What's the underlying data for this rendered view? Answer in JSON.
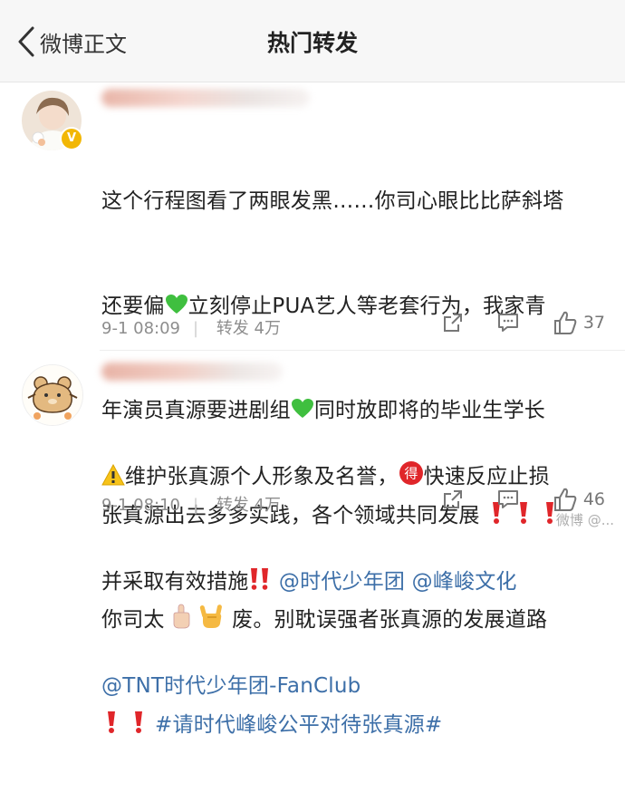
{
  "nav": {
    "back_label": "微博正文",
    "title": "热门转发"
  },
  "posts": [
    {
      "lines": [
        [
          "这个行程图看了两眼发黑……你司心眼比比萨斜塔"
        ],
        [
          "还要偏",
          "立刻停止PUA艺人等老套行为，我家青"
        ],
        [
          "年演员真源要进剧组",
          "同时放即将的毕业生学长"
        ],
        [
          "张真源出去多多实践，各个领域共同发展"
        ],
        [
          "你司太",
          "废。别耽误强者张真源的发展道路"
        ],
        [
          "#请时代峰峻公平对待张真源#"
        ]
      ],
      "time": "9-1 08:09",
      "repost": "转发 4万",
      "likes": "37"
    },
    {
      "lines": [
        [
          "维护张真源个人形象及名誉，",
          "快速反应止损"
        ],
        [
          "并采取有效措施",
          "@时代少年团 @峰峻文化"
        ],
        [
          "@TNT时代少年团-FanClub"
        ]
      ],
      "time": "9-1 08:10",
      "repost": "转发 4万",
      "likes": "46"
    }
  ],
  "badges": {
    "verified": "V",
    "de": "得"
  },
  "colors": {
    "link": "#3d6fa8",
    "heart_green": "#3fbf3f",
    "alert_red": "#e0262a",
    "verified_gold": "#f2b705"
  },
  "icons": [
    "back-chevron-icon",
    "green-heart-icon",
    "red-exclamation-icon",
    "middle-finger-icon",
    "rock-hand-icon",
    "warning-icon",
    "de-badge-icon",
    "double-exclamation-icon",
    "share-icon",
    "comment-icon",
    "like-icon",
    "verified-badge-icon"
  ],
  "watermark": "微博 @..."
}
